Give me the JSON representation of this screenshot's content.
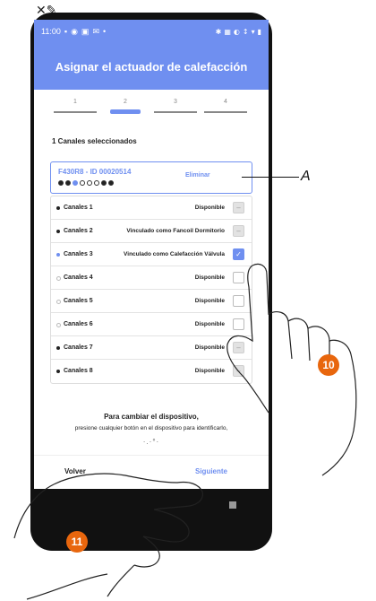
{
  "status_bar": {
    "time": "11:00",
    "left_icons": [
      "image-icon",
      "shield-icon",
      "camera-icon",
      "mail-icon",
      "dot-icon"
    ],
    "right_icons": [
      "bluetooth-icon",
      "nfc-icon",
      "data-icon",
      "wifi-icon",
      "battery-icon"
    ]
  },
  "header": {
    "title": "Asignar el actuador de calefacción"
  },
  "steps": [
    "1",
    "2",
    "3",
    "4"
  ],
  "active_step": 2,
  "selected_title": "1 Canales seleccionados",
  "device": {
    "name": "F430R8 - ID 00020514",
    "remove_label": "Eliminar"
  },
  "channels": [
    {
      "name": "Canales 1",
      "status": "Disponible",
      "state": "disabled",
      "bullet": "filled"
    },
    {
      "name": "Canales 2",
      "status": "Vinculado como  Fancoil Dormitorio",
      "state": "disabled",
      "bullet": "filled"
    },
    {
      "name": "Canales 3",
      "status": "Vinculado como Calefacción Válvula",
      "state": "checked",
      "bullet": "blue"
    },
    {
      "name": "Canales 4",
      "status": "Disponible",
      "state": "empty",
      "bullet": "empty"
    },
    {
      "name": "Canales 5",
      "status": "Disponible",
      "state": "empty",
      "bullet": "empty"
    },
    {
      "name": "Canales 6",
      "status": "Disponible",
      "state": "empty",
      "bullet": "empty"
    },
    {
      "name": "Canales 7",
      "status": "Disponible",
      "state": "disabled",
      "bullet": "filled"
    },
    {
      "name": "Canales 8",
      "status": "Disponible",
      "state": "disabled",
      "bullet": "filled"
    }
  ],
  "info": {
    "title": "Para cambiar el dispositivo,",
    "text": "presione cualquier botón en el dispositivo para identificarlo,"
  },
  "footer": {
    "back_label": "Volver",
    "next_label": "Siguiente"
  },
  "annotations": {
    "label_a": "A",
    "step_10": "10",
    "step_11": "11"
  },
  "colors": {
    "accent": "#6f8ff0",
    "badge": "#e8660d"
  }
}
